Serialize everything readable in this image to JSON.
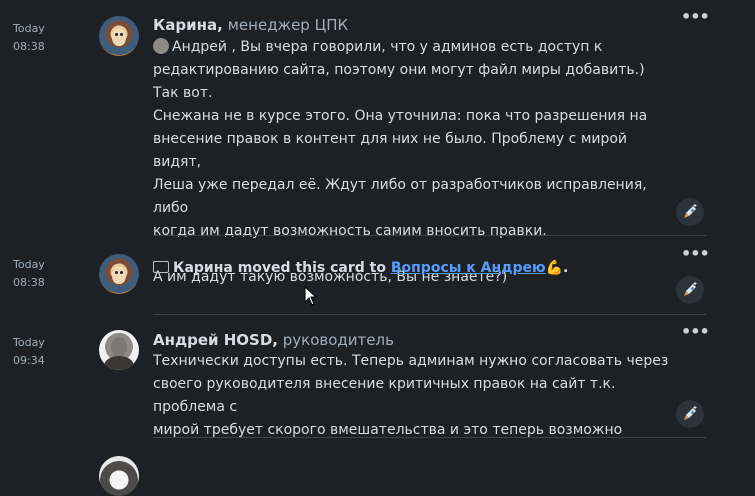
{
  "entries": [
    {
      "day": "Today",
      "time": "08:38",
      "author": "Карина,",
      "role": "менеджер ЦПК",
      "mention": "Андрей",
      "text": " , Вы вчера говорили, что у админов есть доступ к\nредактированию сайта, поэтому они могут файл миры добавить.) Так вот.\nСнежана не в курсе этого. Она уточнила: пока что разрешения на\nвнесение правок в контент для них не было. Проблему с мирой видят,\nЛеша уже передал её. Ждут либо от разработчиков исправления, либо\nкогда им дадут возможность самим вносить правки.\n\nА им дадут такую возможность, Вы не знаете?)"
    },
    {
      "day": "Today",
      "time": "08:38",
      "actor": "Карина",
      "action": " moved this card to ",
      "target": "Вопросы к Андрею",
      "emoji": "💪",
      "suffix": "."
    },
    {
      "day": "Today",
      "time": "09:34",
      "author": "Андрей HOSD,",
      "role": "руководитель",
      "text": "Технически доступы есть. Теперь админам нужно согласовать через\nсвоего руководителя внесение критичных правок на сайт т.к. проблема с\nмирой требует скорого вмешательства и это теперь возможно"
    }
  ],
  "icons": {
    "more": "more-icon",
    "reaction": "rocket-reaction-icon",
    "card": "card-icon"
  },
  "more_glyph": "•••",
  "colors": {
    "background": "#1d2125",
    "text": "#d6dde5",
    "muted": "#9fadbc",
    "link": "#579dff",
    "separator": "#3b444c"
  }
}
